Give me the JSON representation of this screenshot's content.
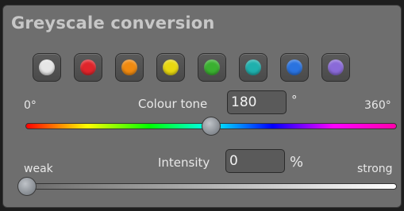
{
  "panel": {
    "title": "Greyscale conversion"
  },
  "swatches": [
    {
      "name": "white-swatch",
      "color": "#e6e6e6"
    },
    {
      "name": "red-swatch",
      "color": "#e0252b"
    },
    {
      "name": "orange-swatch",
      "color": "#f08a10"
    },
    {
      "name": "yellow-swatch",
      "color": "#e8d810"
    },
    {
      "name": "green-swatch",
      "color": "#3ab030"
    },
    {
      "name": "cyan-swatch",
      "color": "#1fb0ad"
    },
    {
      "name": "blue-swatch",
      "color": "#2a73e0"
    },
    {
      "name": "purple-swatch",
      "color": "#8a6ad8"
    }
  ],
  "colour_tone": {
    "min_label": "0°",
    "max_label": "360°",
    "label": "Colour tone",
    "value": "180",
    "unit": "°",
    "fraction": 0.5
  },
  "intensity": {
    "min_label": "weak",
    "max_label": "strong",
    "label": "Intensity",
    "value": "0",
    "unit": "%",
    "fraction": 0.0
  }
}
